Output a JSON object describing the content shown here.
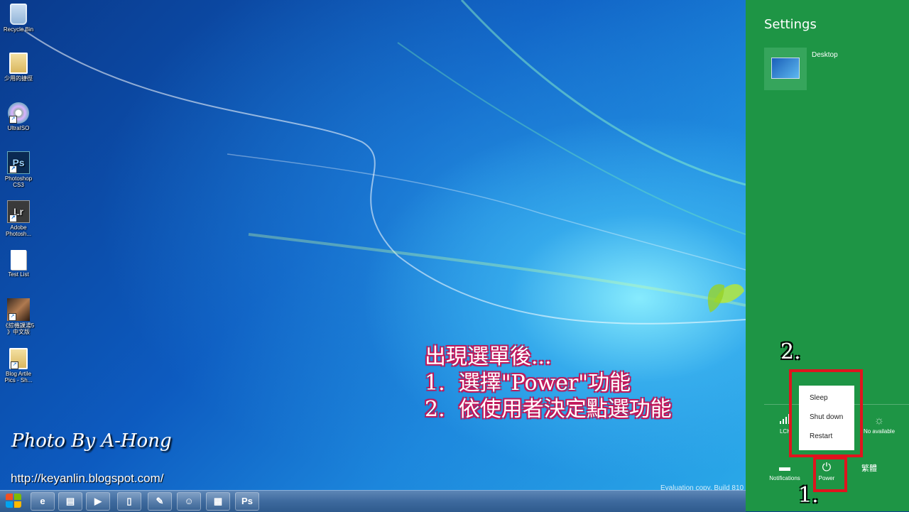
{
  "desktop": {
    "icons": [
      {
        "label": "Recycle Bin",
        "kind": "recycle-bin-icon"
      },
      {
        "label": "少用的捷徑",
        "kind": "folder-icon"
      },
      {
        "label": "UltraISO",
        "kind": "disc-icon"
      },
      {
        "label": "Photoshop\nCS3",
        "kind": "photoshop-icon",
        "glyph": "Ps"
      },
      {
        "label": "Adobe\nPhotosh...",
        "kind": "lightroom-icon",
        "glyph": "Lr"
      },
      {
        "label": "Test List",
        "kind": "text-file-icon"
      },
      {
        "label": "《綜機課湯5\n》中文版",
        "kind": "photo-icon"
      },
      {
        "label": "Blog Artile\nPics - Sh...",
        "kind": "folder-icon"
      }
    ],
    "annotation": {
      "line1": "出現選單後...",
      "line2": "1.  選擇\"Power\"功能",
      "line3": "2.  依使用者決定點選功能"
    },
    "credit": "Photo By A-Hong",
    "url": "http://keyanlin.blogspot.com/",
    "evaluation_text": "Evaluation copy. Build 810"
  },
  "taskbar": {
    "buttons": [
      {
        "name": "ie-taskbar-button",
        "icon": "ie-icon",
        "glyph": "e"
      },
      {
        "name": "explorer-taskbar-button",
        "icon": "folder-icon",
        "glyph": "▤"
      },
      {
        "name": "media-player-taskbar-button",
        "icon": "play-icon",
        "glyph": "▶"
      },
      {
        "name": "app-taskbar-button-1",
        "icon": "document-icon",
        "glyph": "▯"
      },
      {
        "name": "app-taskbar-button-2",
        "icon": "paint-icon",
        "glyph": "✎"
      },
      {
        "name": "app-taskbar-button-3",
        "icon": "people-icon",
        "glyph": "☺"
      },
      {
        "name": "app-taskbar-button-4",
        "icon": "film-icon",
        "glyph": "▦"
      },
      {
        "name": "photoshop-taskbar-button",
        "icon": "photoshop-icon",
        "glyph": "Ps"
      }
    ]
  },
  "charm": {
    "title": "Settings",
    "tile_label": "Desktop",
    "quick": {
      "network": "LCH",
      "brightness": "No available",
      "notifications": "Notifications",
      "power": "Power",
      "language": "繁體"
    },
    "power_menu": [
      "Sleep",
      "Shut down",
      "Restart"
    ],
    "step1": "1.",
    "step2": "2."
  },
  "colors": {
    "charm_bg": "#1e9545",
    "highlight_red": "#e0141e",
    "annotation_outline": "#c2185b"
  }
}
